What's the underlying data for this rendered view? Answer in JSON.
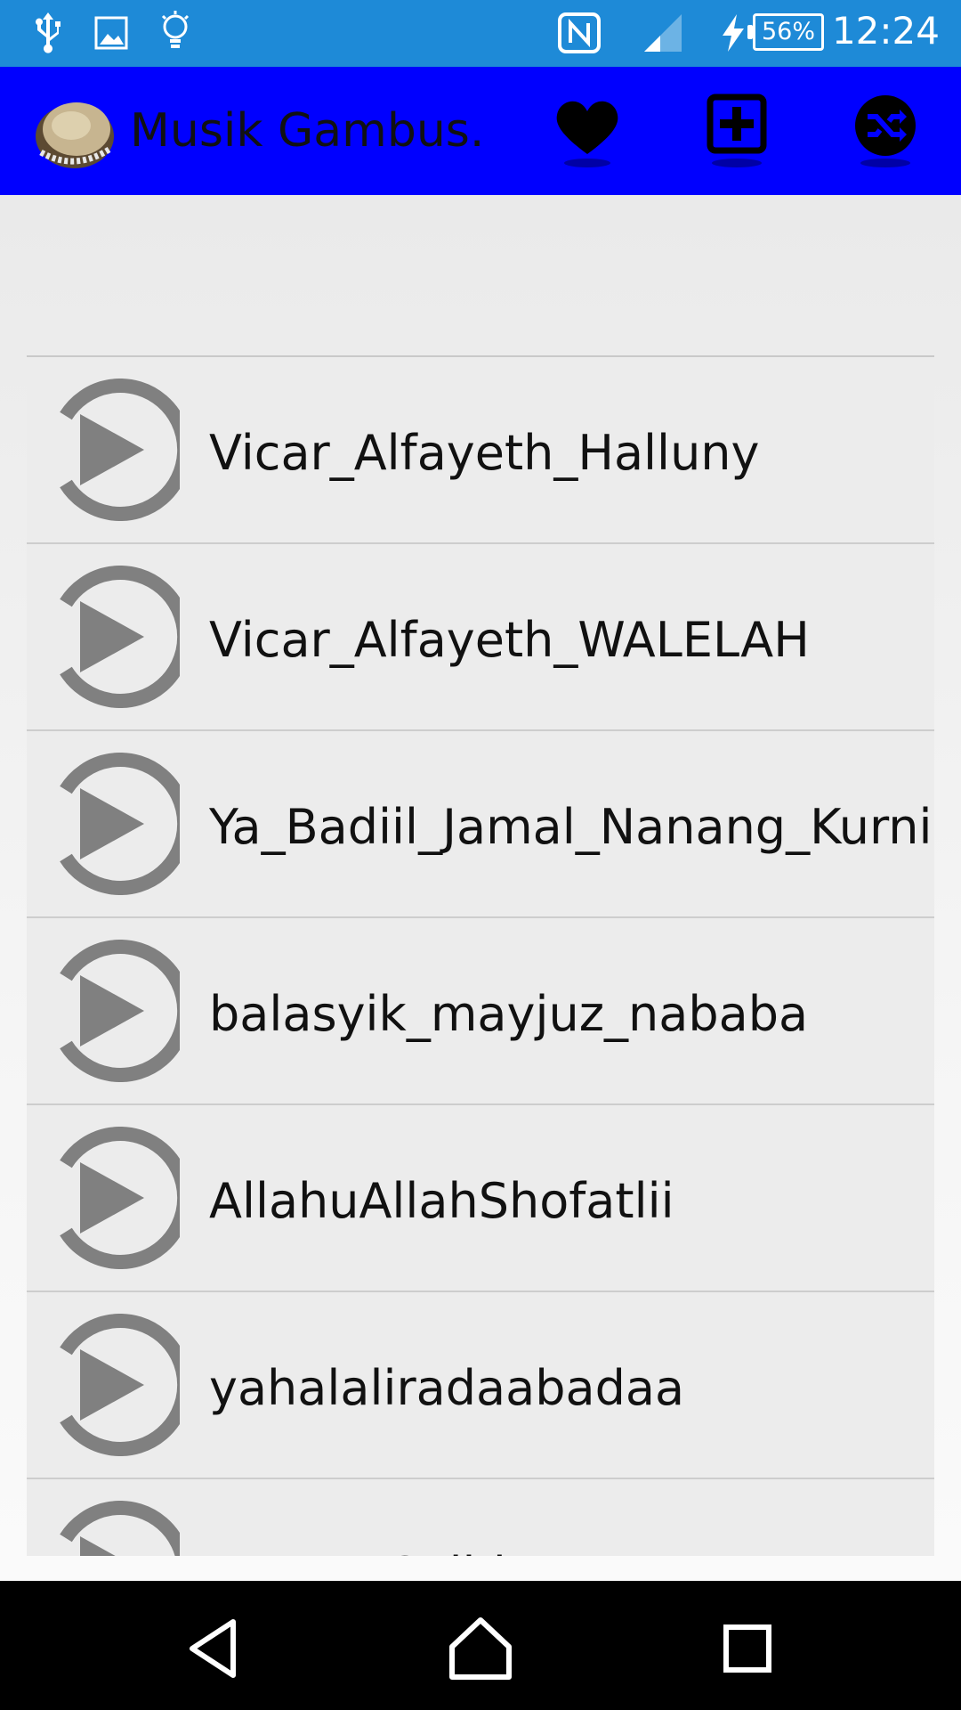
{
  "status_bar": {
    "icons": [
      "usb-icon",
      "image-icon",
      "lightbulb-icon",
      "nfc-icon",
      "signal-icon",
      "charging-icon"
    ],
    "battery": "56%",
    "time": "12:24",
    "color": "#1e8ad7"
  },
  "app_bar": {
    "title": "Musik Gambus...",
    "color": "#0000ff",
    "actions": [
      "favorite-heart-icon",
      "add-playlist-icon",
      "shuffle-icon"
    ]
  },
  "songs": [
    {
      "title": "Vicar_Alfayeth_Halluny"
    },
    {
      "title": "Vicar_Alfayeth_WALELAH"
    },
    {
      "title": "Ya_Badiil_Jamal_Nanang_Kurnia"
    },
    {
      "title": "balasyik_mayjuz_nababa"
    },
    {
      "title": "AllahuAllahShofatlii"
    },
    {
      "title": "yahalaliradaabadaa"
    },
    {
      "title": "Hanna_Salhi"
    }
  ],
  "nav_bar": {
    "buttons": [
      "back-icon",
      "home-icon",
      "recents-icon"
    ]
  }
}
